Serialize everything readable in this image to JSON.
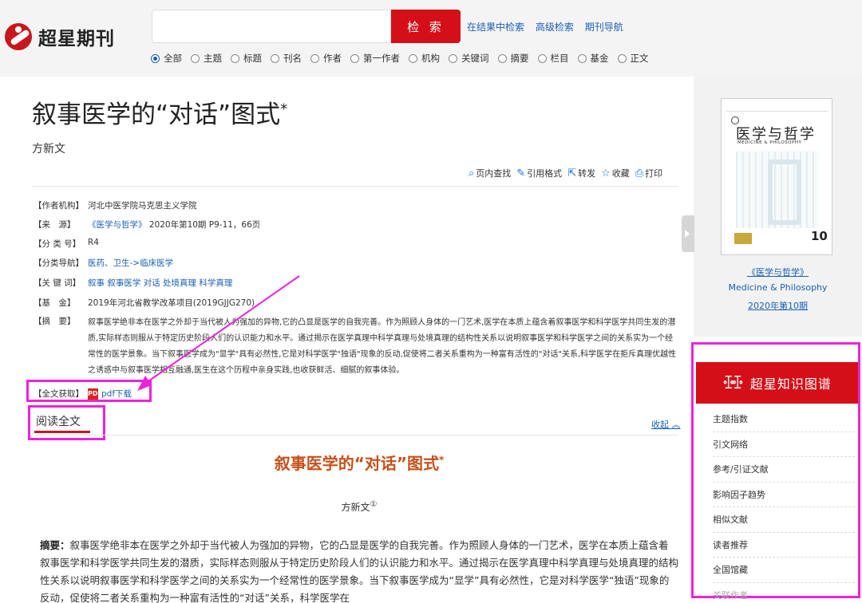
{
  "header": {
    "logo_text": "超星期刊",
    "search_placeholder": "",
    "search_button": "检 索",
    "links": [
      "在结果中检索",
      "高级检索",
      "期刊导航"
    ],
    "search_options": [
      "全部",
      "主题",
      "标题",
      "刊名",
      "作者",
      "第一作者",
      "机构",
      "关键词",
      "摘要",
      "栏目",
      "基金",
      "正文"
    ],
    "selected_option": "全部"
  },
  "article": {
    "title": "叙事医学的“对话”图式",
    "title_mark": "*",
    "author": "方新文",
    "tools": [
      "页内查找",
      "引用格式",
      "转发",
      "收藏",
      "打印"
    ]
  },
  "meta": {
    "affiliation_label": "【作者机构】",
    "affiliation": "河北中医学院马克思主义学院",
    "source_label": "【来　源】",
    "source_journal": "《医学与哲学》",
    "source_detail": "2020年第10期 P9-11，66页",
    "class_label": "【分 类 号】",
    "class_no": "R4",
    "nav_label": "【分类导航】",
    "nav_value": "医药、卫生->临床医学",
    "keywords_label": "【关 键 词】",
    "keywords": "叙事 叙事医学 对话 处境真理 科学真理",
    "fund_label": "【基　金】",
    "fund": "2019年河北省教学改革项目(2019GJJG270)",
    "abstract_label": "【摘　要】",
    "abstract": "叙事医学绝非本在医学之外却于当代被人为强加的异物,它的凸显是医学的自我完善。作为照顾人身体的一门艺术,医学在本质上蕴含着叙事医学和科学医学共同生发的潜质,实际样态则服从于特定历史阶段人们的认识能力和水平。通过揭示在医学真理中科学真理与处境真理的结构性关系以说明叙事医学和科学医学之间的关系实为一个经常性的医学景象。当下叙事医学成为\"显学\"具有必然性,它是对科学医学\"独语\"现象的反动,促使将二者关系重构为一种富有活性的\"对话\"关系,科学医学在拒斥真理优越性之诱惑中与叙事医学相互融通,医生在这个历程中亲身实践,也收获鲜活、细腻的叙事体验。",
    "fulltext_label": "【全文获取】",
    "pdf_icon": "PDF",
    "pdf_link": "pdf下载"
  },
  "read": {
    "tab": "阅读全文",
    "collapse": "收起 ︽",
    "title": "叙事医学的“对话”图式",
    "title_mark": "*",
    "author": "方新文",
    "author_mark": "①",
    "abstract_label": "摘要：",
    "abstract": "叙事医学绝非本在医学之外却于当代被人为强加的异物，它的凸显是医学的自我完善。作为照顾人身体的一门艺术，医学在本质上蕴含着叙事医学和科学医学共同生发的潜质，实际样态则服从于特定历史阶段人们的认识能力和水平。通过揭示在医学真理中科学真理与处境真理的结构性关系以说明叙事医学和科学医学之间的关系实为一个经常性的医学景象。当下叙事医学成为“显学”具有必然性，它是对科学医学“独语”现象的反动，促使将二者关系重构为一种富有活性的“对话”关系，科学医学在"
  },
  "sidebar": {
    "cover_title": "医学与哲学",
    "cover_subtitle": "MEDICINE & PHILOSOPHY",
    "cover_number": "10",
    "journal_name": "《医学与哲学》",
    "journal_en": "Medicine & Philosophy",
    "journal_issue": "2020年第10期",
    "kg_icon": "ꔀꔀ",
    "kg_title": "超星知识图谱",
    "kg_items": [
      "主题指数",
      "引文网络",
      "参考/引证文献",
      "影响因子趋势",
      "相似文献",
      "读者推荐",
      "全国馆藏",
      "关联作者"
    ]
  },
  "colors": {
    "brand_red": "#d40f17",
    "link_blue": "#1a5fb4",
    "annotation_pink": "#ee22dd",
    "article_title": "#c8501a"
  }
}
